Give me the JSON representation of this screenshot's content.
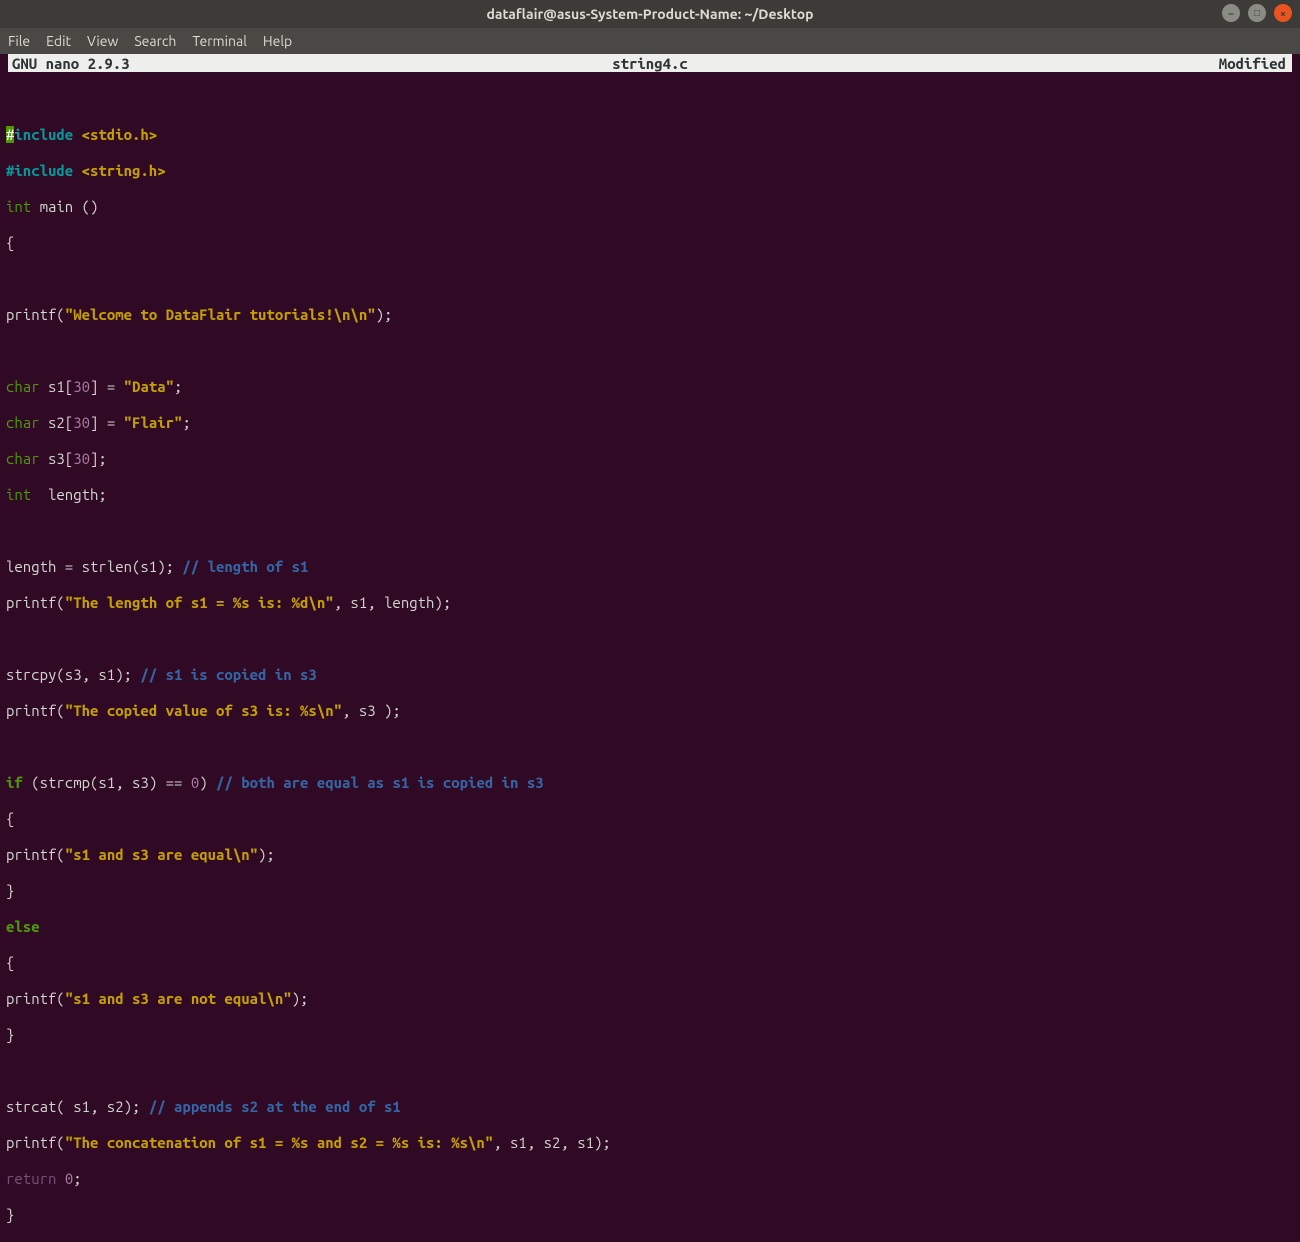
{
  "window": {
    "title": "dataflair@asus-System-Product-Name: ~/Desktop"
  },
  "menu": {
    "file": "File",
    "edit": "Edit",
    "view": "View",
    "search": "Search",
    "terminal": "Terminal",
    "help": "Help"
  },
  "nano": {
    "brand": "  GNU nano 2.9.3",
    "filename": "string4.c",
    "modified": "Modified"
  },
  "code": {
    "cursor_char": "#",
    "l1a": "include ",
    "l1b": "<stdio.h>",
    "l2a": "#include ",
    "l2b": "<string.h>",
    "l3a": "int",
    "l3b": " main ()",
    "l4": "{",
    "l6a": "printf(",
    "l6b": "\"Welcome to DataFlair tutorials!\\n\\n\"",
    "l6c": ");",
    "l8a": "char",
    "l8b": " s1[",
    "l8c": "30",
    "l8d": "] = ",
    "l8e": "\"Data\"",
    "l8f": ";",
    "l9b": " s2[",
    "l9e": "\"Flair\"",
    "l10b": " s3[",
    "l10d": "];",
    "l11a": "int",
    "l11b": "  length;",
    "l13a": "length = strlen(s1); ",
    "l13b": "// length of s1",
    "l14a": "printf(",
    "l14b": "\"The length of s1 = %s is: %d\\n\"",
    "l14c": ", s1, length);",
    "l16a": "strcpy(s3, s1); ",
    "l16b": "// s1 is copied in s3",
    "l17a": "printf(",
    "l17b": "\"The copied value of s3 is: %s\\n\"",
    "l17c": ", s3 );",
    "l19a": "if",
    "l19b": " (strcmp(s1, s3) == ",
    "l19c": "0",
    "l19d": ") ",
    "l19e": "// both are equal as s1 is copied in s3",
    "l20": "{",
    "l21a": "printf(",
    "l21b": "\"s1 and s3 are equal\\n\"",
    "l21c": ");",
    "l22": "}",
    "l23": "else",
    "l24": "{",
    "l25a": "printf(",
    "l25b": "\"s1 and s3 are not equal\\n\"",
    "l25c": ");",
    "l26": "}",
    "l28a": "strcat( s1, s2); ",
    "l28b": "// appends s2 at the end of s1",
    "l29a": "printf(",
    "l29b": "\"The concatenation of s1 = %s and s2 = %s is: %s\\n\"",
    "l29c": ", s1, s2, s1);",
    "l30a": "return",
    "l30b": " ",
    "l30c": "0",
    "l30d": ";",
    "l31": "}"
  }
}
